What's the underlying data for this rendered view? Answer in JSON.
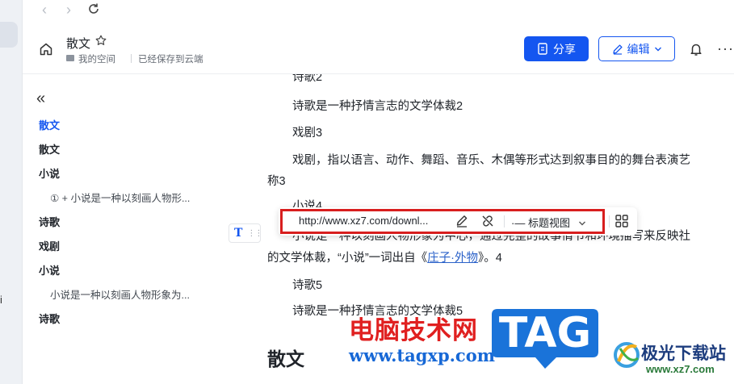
{
  "colors": {
    "accent": "#1456f0",
    "highlight_box": "#d81e1e",
    "watermark_red": "#e02020",
    "watermark_blue": "#1768d6"
  },
  "header": {
    "title": "散文",
    "space": "我的空间",
    "saved_status": "已经保存到云端",
    "share_label": "分享",
    "edit_label": "编辑"
  },
  "outline": {
    "items": [
      {
        "label": "散文"
      },
      {
        "label": "散文"
      },
      {
        "label": "小说"
      },
      {
        "label": "① + 小说是一种以刻画人物形..."
      },
      {
        "label": "诗歌"
      },
      {
        "label": "戏剧"
      },
      {
        "label": "小说"
      },
      {
        "label": "小说是一种以刻画人物形象为..."
      },
      {
        "label": "诗歌"
      }
    ]
  },
  "doc": {
    "lines": [
      "诗歌2",
      "诗歌是一种抒情言志的文学体裁2",
      "戏剧3",
      "戏剧，指以语言、动作、舞蹈、音乐、木偶等形式达到叙事目的的舞台表演艺",
      "称3",
      "小说4",
      "小说是一种以刻画人物形象为中心，通过完整的故事情节和环境描写来反映社",
      "的文学体裁，“小说”一词出自《",
      "庄子·外物",
      "》。4",
      "诗歌5",
      "诗歌是一种抒情言志的文学体裁5"
    ],
    "heading": "散文"
  },
  "link_toolbar": {
    "url": "http://www.xz7.com/downl...",
    "view_label": "标题视图",
    "text_type_icon": "T"
  },
  "watermark": {
    "cn_text": "电脑技术网",
    "url_text": "www.tagxp.com",
    "tag_text": "TAG",
    "jg_text": "极光下载站",
    "jg_url": "www.xz7.com"
  }
}
